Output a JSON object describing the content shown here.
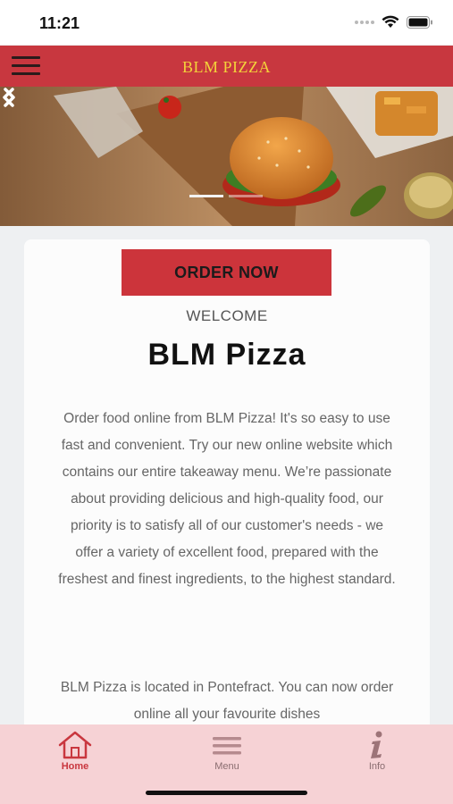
{
  "status_bar": {
    "time": "11:21"
  },
  "header": {
    "title": "BLM PIZZA",
    "menu_icon": "hamburger-icon"
  },
  "hero": {
    "prev_icon": "chevron-left-icon",
    "next_icon": "chevron-right-icon",
    "slide_count": 2,
    "active_slide": 1
  },
  "main": {
    "order_button": "ORDER NOW",
    "welcome": "WELCOME",
    "brand": "BLM Pizza",
    "paragraph1": "Order food online from BLM Pizza! It's so easy to use fast and convenient. Try our new online website which contains our entire takeaway menu. We’re passionate about providing delicious and high-quality food, our priority is to satisfy all of our customer's needs - we offer a variety of excellent food, prepared with the freshest and finest ingredients, to the highest standard.",
    "paragraph2": "BLM Pizza is located in Pontefract. You can now order online all your favourite dishes"
  },
  "tabs": [
    {
      "label": "Home",
      "icon": "home-icon",
      "active": true
    },
    {
      "label": "Menu",
      "icon": "menu-lines-icon",
      "active": false
    },
    {
      "label": "Info",
      "icon": "info-icon",
      "active": false
    }
  ],
  "colors": {
    "brand_red": "#c8373f",
    "title_gold": "#f3d23a",
    "tab_bar_bg": "#f6d2d5"
  }
}
